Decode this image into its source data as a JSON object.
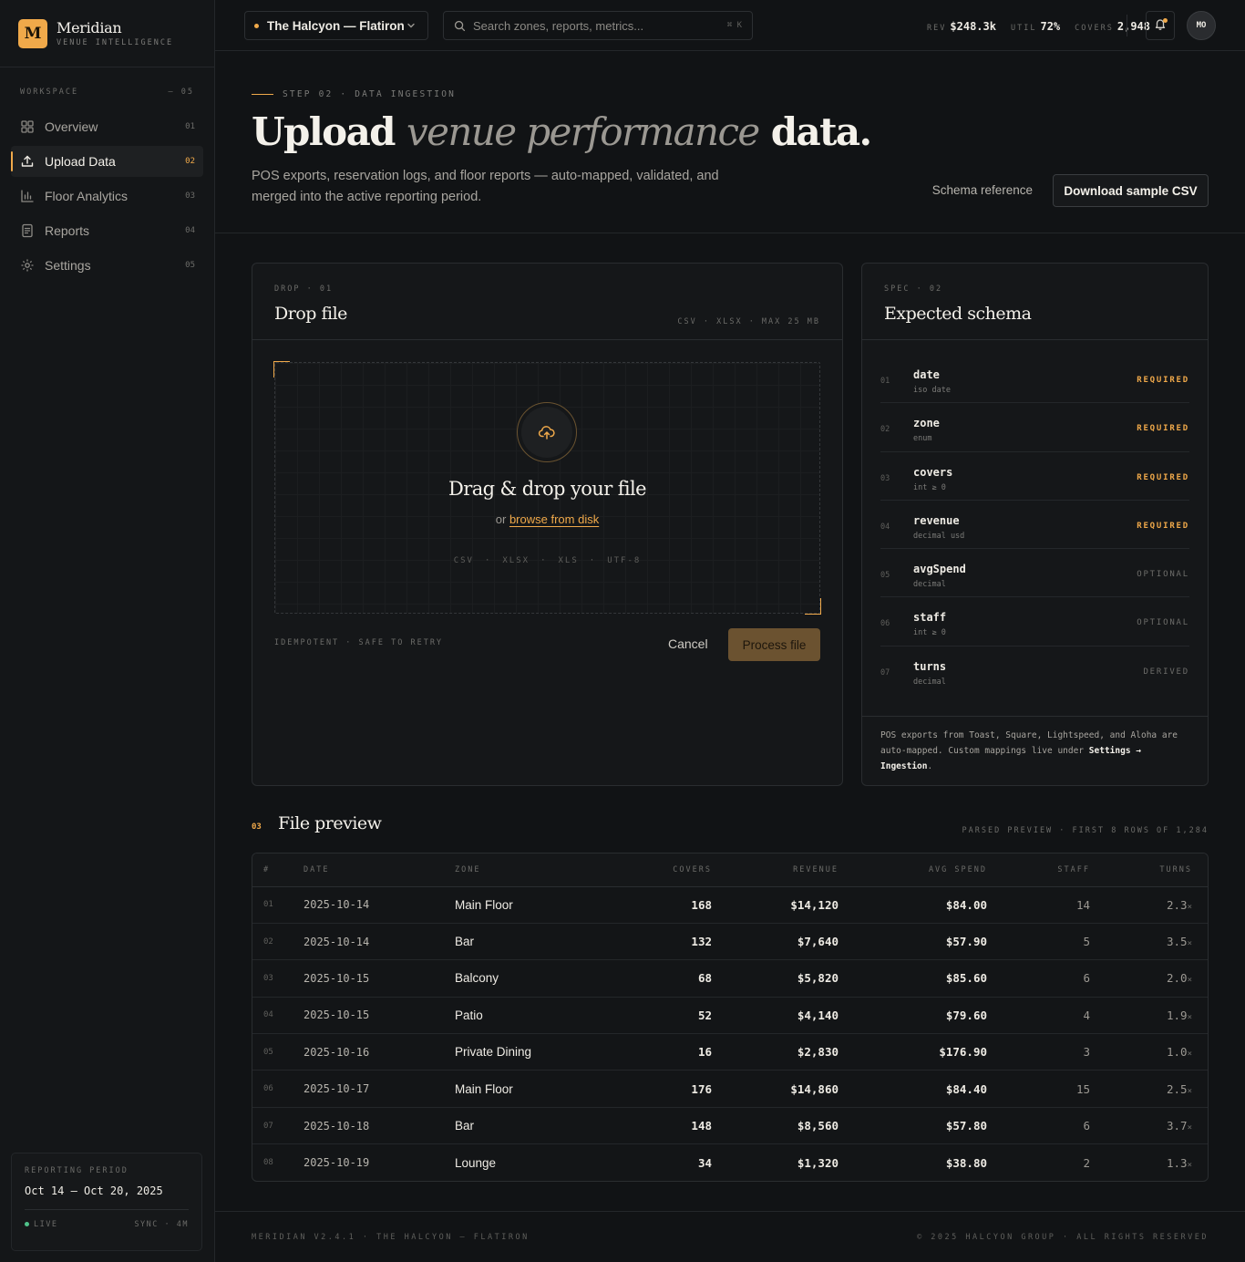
{
  "brand": {
    "logo_letter": "M",
    "name": "Meridian",
    "tagline": "VENUE INTELLIGENCE"
  },
  "sidebar": {
    "section_label": "WORKSPACE",
    "section_count": "— 05",
    "items": [
      {
        "label": "Overview",
        "num": "01",
        "icon": "grid-icon",
        "active": false
      },
      {
        "label": "Upload Data",
        "num": "02",
        "icon": "upload-icon",
        "active": true
      },
      {
        "label": "Floor Analytics",
        "num": "03",
        "icon": "bar-chart-icon",
        "active": false
      },
      {
        "label": "Reports",
        "num": "04",
        "icon": "document-icon",
        "active": false
      },
      {
        "label": "Settings",
        "num": "05",
        "icon": "gear-icon",
        "active": false
      }
    ],
    "period": {
      "label": "REPORTING PERIOD",
      "value": "Oct 14 – Oct 20, 2025",
      "status": "LIVE",
      "sync": "SYNC · 4M"
    }
  },
  "topbar": {
    "venue": "The Halcyon — Flatiron",
    "search_placeholder": "Search zones, reports, metrics...",
    "search_shortcut": "⌘ K",
    "stats": [
      {
        "key": "REV",
        "value": "$248.3k"
      },
      {
        "key": "UTIL",
        "value": "72%"
      },
      {
        "key": "COVERS",
        "value": "2,948"
      }
    ],
    "avatar": "MO"
  },
  "hero": {
    "step": "STEP 02 · DATA INGESTION",
    "title_pre": "Upload ",
    "title_em": "venue performance",
    "title_post": " data.",
    "lead": "POS exports, reservation logs, and floor reports — auto-mapped, validated, and merged into the active reporting period.",
    "schema_link": "Schema reference",
    "download_btn": "Download sample CSV"
  },
  "drop": {
    "kicker": "DROP · 01",
    "title": "Drop file",
    "meta": "CSV · XLSX · MAX 25 MB",
    "dz_title": "Drag & drop your file",
    "dz_or": "or ",
    "dz_link": "browse from disk",
    "types": [
      "CSV",
      "XLSX",
      "XLS",
      "UTF-8"
    ],
    "note": "IDEMPOTENT · SAFE TO RETRY",
    "cancel": "Cancel",
    "process": "Process file"
  },
  "schema": {
    "kicker": "SPEC · 02",
    "title": "Expected schema",
    "fields": [
      {
        "n": "01",
        "name": "date",
        "type": "iso date",
        "badge": "REQUIRED"
      },
      {
        "n": "02",
        "name": "zone",
        "type": "enum",
        "badge": "REQUIRED"
      },
      {
        "n": "03",
        "name": "covers",
        "type": "int ≥ 0",
        "badge": "REQUIRED"
      },
      {
        "n": "04",
        "name": "revenue",
        "type": "decimal usd",
        "badge": "REQUIRED"
      },
      {
        "n": "05",
        "name": "avgSpend",
        "type": "decimal",
        "badge": "OPTIONAL"
      },
      {
        "n": "06",
        "name": "staff",
        "type": "int ≥ 0",
        "badge": "OPTIONAL"
      },
      {
        "n": "07",
        "name": "turns",
        "type": "decimal",
        "badge": "DERIVED"
      }
    ],
    "note_pre": "POS exports from Toast, Square, Lightspeed, and Aloha are auto-mapped. Custom mappings live under ",
    "note_bold": "Settings → Ingestion",
    "note_post": "."
  },
  "preview": {
    "num": "03",
    "title": "File preview",
    "meta": "PARSED PREVIEW · FIRST 8 ROWS OF 1,284",
    "columns": [
      "#",
      "DATE",
      "ZONE",
      "COVERS",
      "REVENUE",
      "AVG SPEND",
      "STAFF",
      "TURNS"
    ],
    "turns_suffix": "×",
    "rows": [
      {
        "idx": "01",
        "date": "2025-10-14",
        "zone": "Main Floor",
        "covers": "168",
        "revenue": "$14,120",
        "avg": "$84.00",
        "staff": "14",
        "turns": "2.3"
      },
      {
        "idx": "02",
        "date": "2025-10-14",
        "zone": "Bar",
        "covers": "132",
        "revenue": "$7,640",
        "avg": "$57.90",
        "staff": "5",
        "turns": "3.5"
      },
      {
        "idx": "03",
        "date": "2025-10-15",
        "zone": "Balcony",
        "covers": "68",
        "revenue": "$5,820",
        "avg": "$85.60",
        "staff": "6",
        "turns": "2.0"
      },
      {
        "idx": "04",
        "date": "2025-10-15",
        "zone": "Patio",
        "covers": "52",
        "revenue": "$4,140",
        "avg": "$79.60",
        "staff": "4",
        "turns": "1.9"
      },
      {
        "idx": "05",
        "date": "2025-10-16",
        "zone": "Private Dining",
        "covers": "16",
        "revenue": "$2,830",
        "avg": "$176.90",
        "staff": "3",
        "turns": "1.0"
      },
      {
        "idx": "06",
        "date": "2025-10-17",
        "zone": "Main Floor",
        "covers": "176",
        "revenue": "$14,860",
        "avg": "$84.40",
        "staff": "15",
        "turns": "2.5"
      },
      {
        "idx": "07",
        "date": "2025-10-18",
        "zone": "Bar",
        "covers": "148",
        "revenue": "$8,560",
        "avg": "$57.80",
        "staff": "6",
        "turns": "3.7"
      },
      {
        "idx": "08",
        "date": "2025-10-19",
        "zone": "Lounge",
        "covers": "34",
        "revenue": "$1,320",
        "avg": "$38.80",
        "staff": "2",
        "turns": "1.3"
      }
    ]
  },
  "footer": {
    "left": "MERIDIAN V2.4.1 · THE HALCYON — FLATIRON",
    "right": "© 2025 HALCYON GROUP · ALL RIGHTS RESERVED"
  },
  "colors": {
    "accent": "#f0a94a",
    "bg": "#111315",
    "live": "#4fc28a"
  }
}
